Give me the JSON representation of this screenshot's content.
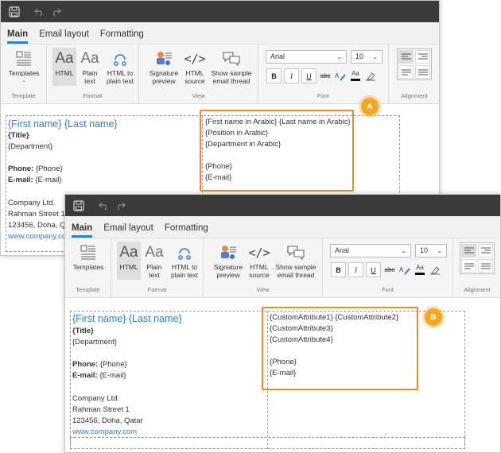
{
  "tabs": [
    "Main",
    "Email layout",
    "Formatting"
  ],
  "ribbon": {
    "templates_label": "Templates",
    "template_group": "Template",
    "format_group": "Format",
    "view_group": "View",
    "font_group": "Font",
    "alignment_group": "Alignment",
    "html_glyph": "Aa",
    "html_label": "HTML",
    "plain_glyph": "Aa",
    "plain_label_1": "Plain",
    "plain_label_2": "text",
    "h2p_label_1": "HTML to",
    "h2p_label_2": "plain text",
    "sigprev_label_1": "Signature",
    "sigprev_label_2": "preview",
    "htmlsrc_label_1": "HTML",
    "htmlsrc_label_2": "source",
    "sample_label_1": "Show sample",
    "sample_label_2": "email thread",
    "font_name": "Arial",
    "font_size": "10",
    "bold": "B",
    "italic": "I",
    "underline": "U",
    "strike": "abc",
    "font_color_glyph": "Aa"
  },
  "signature": {
    "name": "{First name} {Last name}",
    "title": "{Title}",
    "department": "{Department}",
    "phone_label": "Phone:",
    "phone_value": " {Phone}",
    "email_label": "E-mail:",
    "email_value": " {E-mail}",
    "company": "Company Ltd.",
    "street": "Rahman Street 1",
    "city": "123456, Doha, Qatar",
    "website": "www.company.com"
  },
  "window_a": {
    "callout": "A",
    "city_cut": "123456, Doha, Q",
    "street_cut": "Rahman Street 1",
    "website_cut": "www.company.co",
    "right": [
      "{First name in Arabic} {Last name in Arabic}",
      "{Position in Arabic}",
      "{Department in Arabic}",
      "{Phone}",
      "{E-mail}"
    ]
  },
  "window_b": {
    "callout": "B",
    "right": [
      "{CustomAttribute1} {CustomAttribute2}",
      "{CustomAttribute3}",
      "{CustomAttribute4}",
      "{Phone}",
      "{E-mail}"
    ]
  },
  "colors": {
    "accent": "#2d7fd3",
    "highlight": "#f08a24",
    "titlebar": "#3a3a3a"
  }
}
